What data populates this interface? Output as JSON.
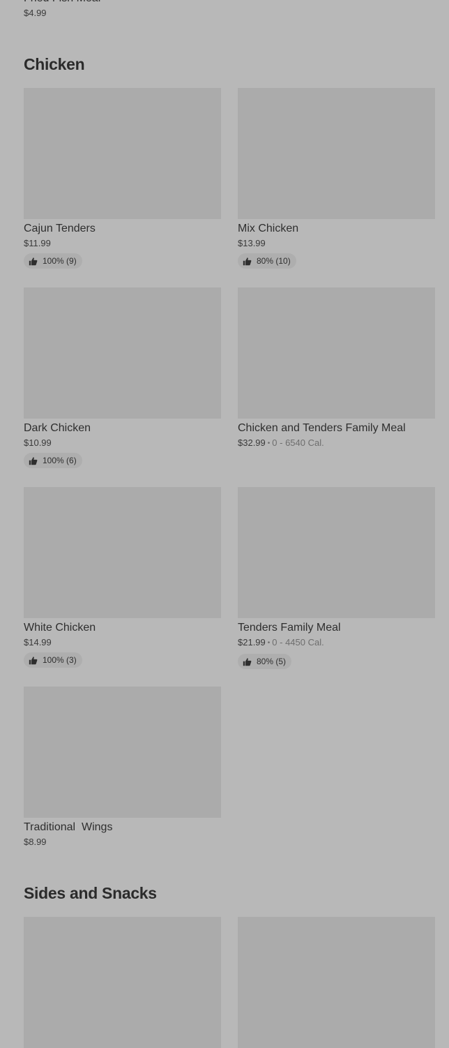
{
  "previous_item": {
    "name": "Fried Fish Meal",
    "price": "$4.99"
  },
  "sections": [
    {
      "title": "Chicken",
      "items": [
        {
          "name": "Cajun Tenders",
          "price": "$11.99",
          "calories": "",
          "rating": "100% (9)"
        },
        {
          "name": "Mix Chicken",
          "price": "$13.99",
          "calories": "",
          "rating": "80% (10)"
        },
        {
          "name": "Dark Chicken",
          "price": "$10.99",
          "calories": "",
          "rating": "100% (6)"
        },
        {
          "name": "Chicken and Tenders Family Meal",
          "price": "$32.99",
          "calories": "0 - 6540 Cal.",
          "rating": ""
        },
        {
          "name": "White Chicken",
          "price": "$14.99",
          "calories": "",
          "rating": "100% (3)"
        },
        {
          "name": "Tenders Family Meal",
          "price": "$21.99",
          "calories": "0 - 4450 Cal.",
          "rating": "80% (5)"
        },
        {
          "name": "Traditional  Wings",
          "price": "$8.99",
          "calories": "",
          "rating": ""
        }
      ]
    },
    {
      "title": "Sides and Snacks",
      "items": []
    }
  ],
  "icons": {
    "rating": "thumbs-up-icon"
  },
  "colors": {
    "background": "#b8b8b8",
    "thumbnail": "#ababab",
    "rating_pill": "#aeaeae"
  }
}
